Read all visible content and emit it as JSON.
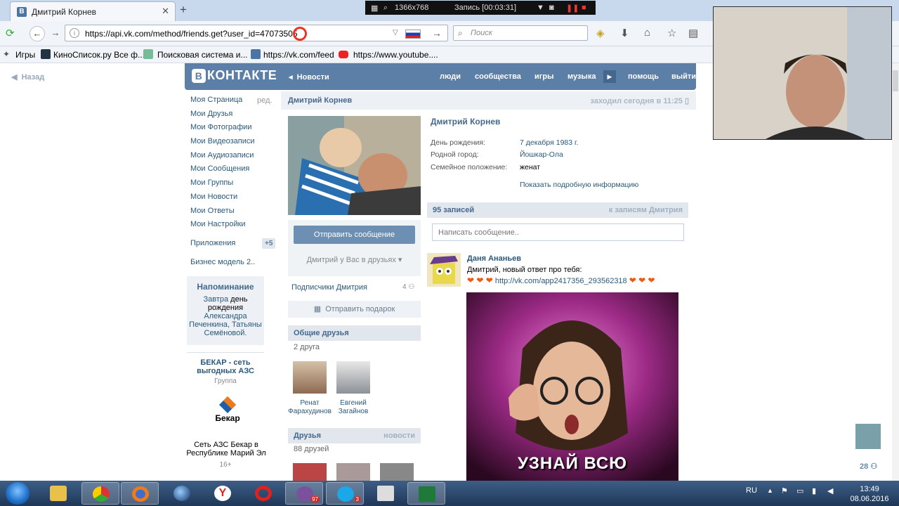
{
  "browser": {
    "tab_title": "Дмитрий Корнев",
    "url": "https://api.vk.com/method/friends.get?user_id=47073505",
    "search_placeholder": "Поиск",
    "recorder_resolution": "1366x768",
    "recorder_status": "Запись [00:03:31]",
    "bookmarks": [
      "Игры",
      "КиноСписок.ру Все ф...",
      "Поисковая система и...",
      "https://vk.com/feed",
      "https://www.youtube...."
    ]
  },
  "vk": {
    "back_label": "Назад",
    "logo": "КОНТАКТЕ",
    "logo_letter": "В",
    "header_nav": [
      "Новости",
      "люди",
      "сообщества",
      "игры",
      "музыка",
      "помощь",
      "выйти"
    ],
    "left_menu": [
      "Моя Страница",
      "Мои Друзья",
      "Мои Фотографии",
      "Мои Видеозаписи",
      "Мои Аудиозаписи",
      "Мои Сообщения",
      "Мои Группы",
      "Мои Новости",
      "Мои Ответы",
      "Мои Настройки"
    ],
    "left_menu_edit": "ред.",
    "apps_label": "Приложения",
    "apps_badge": "+5",
    "biz_label": "Бизнес модель 2..",
    "reminder": {
      "title": "Напоминание",
      "line1a": "Завтра",
      "line1b": "день",
      "line2": "рождения",
      "line3": "Александра",
      "line4a": "Печенкина,",
      "line4b": "Татьяны",
      "line5": "Семёновой."
    },
    "ad": {
      "title": "БЕКАР - сеть выгодных АЗС",
      "sub": "Группа",
      "logo_text": "Бекар",
      "desc": "Сеть АЗС Бекар в Республике Марий Эл",
      "age": "16+"
    },
    "profile": {
      "head_name": "Дмитрий Корнев",
      "last_seen": "заходил сегодня в 11:25",
      "name": "Дмитрий Корнев",
      "fields": [
        {
          "label": "День рождения:",
          "value": "7 декабря 1983 г."
        },
        {
          "label": "Родной город:",
          "value": "Йошкар-Ола"
        },
        {
          "label": "Семейное положение:",
          "value": "женат"
        }
      ],
      "show_more": "Показать подробную информацию",
      "send_message": "Отправить сообщение",
      "in_friends": "Дмитрий у Вас в друзьях",
      "subscribers": "Подписчики Дмитрия",
      "subscribers_count": "4",
      "gift": "Отправить подарок",
      "common_friends_head": "Общие друзья",
      "common_friends_count": "2 друга",
      "common_friends": [
        "Ренат Фарахудинов",
        "Евгений Загайнов"
      ],
      "friends_head": "Друзья",
      "friends_news": "новости",
      "friends_count": "88 друзей"
    },
    "wall": {
      "count": "95 записей",
      "link": "к записям Дмитрия",
      "input_placeholder": "Написать сообщение..",
      "post_author": "Даня Ананьев",
      "post_text": "Дмитрий, новый ответ про тебя:",
      "post_link": "http://vk.com/app2417356_293562318",
      "post_image_text": "УЗНАЙ ВСЮ"
    },
    "right_count": "28"
  },
  "taskbar": {
    "lang": "RU",
    "time": "13:49",
    "date": "08.06.2016",
    "viber_badge": "97",
    "skype_badge": "3"
  }
}
